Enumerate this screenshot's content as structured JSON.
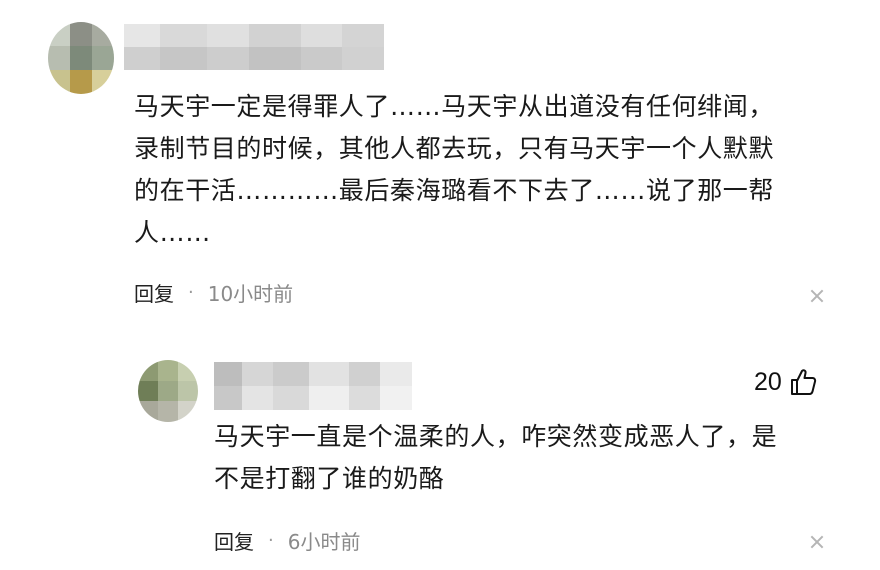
{
  "comments": [
    {
      "text_lines": [
        "马天宇一定是得罪人了……马天宇从出道没有任何绯闻，",
        "录制节目的时候，其他人都去玩，只有马天宇一个人默默",
        "的在干活…………最后秦海璐看不下去了……说了那一帮",
        "人……"
      ],
      "reply_label": "回复",
      "separator": "·",
      "time": "10小时前"
    },
    {
      "text_lines": [
        "马天宇一直是个温柔的人，咋突然变成恶人了，是",
        "不是打翻了谁的奶酪"
      ],
      "like_count": "20",
      "reply_label": "回复",
      "separator": "·",
      "time": "6小时前"
    }
  ],
  "icons": {
    "close": "close-icon",
    "like": "thumbs-up-icon"
  }
}
